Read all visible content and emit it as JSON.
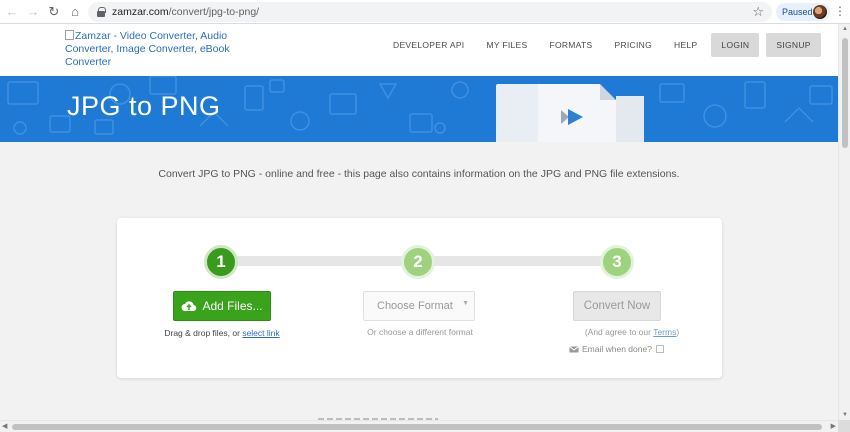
{
  "browser": {
    "url_host": "zamzar.com",
    "url_path": "/convert/jpg-to-png/",
    "profile_status": "Paused",
    "back_glyph": "←",
    "forward_glyph": "→",
    "reload_glyph": "↻",
    "home_glyph": "⌂",
    "star_glyph": "☆",
    "menu_glyph": "⋮"
  },
  "header": {
    "logo_alt": "Zamzar - Video Converter, Audio Converter, Image Converter, eBook Converter",
    "nav": [
      "DEVELOPER API",
      "MY FILES",
      "FORMATS",
      "PRICING",
      "HELP"
    ],
    "login": "LOGIN",
    "signup": "SIGNUP"
  },
  "banner": {
    "title": "JPG to PNG",
    "bg_color": "#1f7ad6"
  },
  "intro": "Convert JPG to PNG - online and free - this page also contains information on the JPG and PNG file extensions.",
  "converter": {
    "steps": [
      "1",
      "2",
      "3"
    ],
    "add_files": "Add Files...",
    "drag_drop": "Drag & drop files, or ",
    "select_link": "select link",
    "choose_format": "Choose Format",
    "choose_hint": "Or choose a different format",
    "convert_now": "Convert Now",
    "terms_prefix": "(And agree to our ",
    "terms_link": "Terms",
    "terms_suffix": ")",
    "email_label": "Email when done?",
    "accent": "#3aa31c"
  }
}
